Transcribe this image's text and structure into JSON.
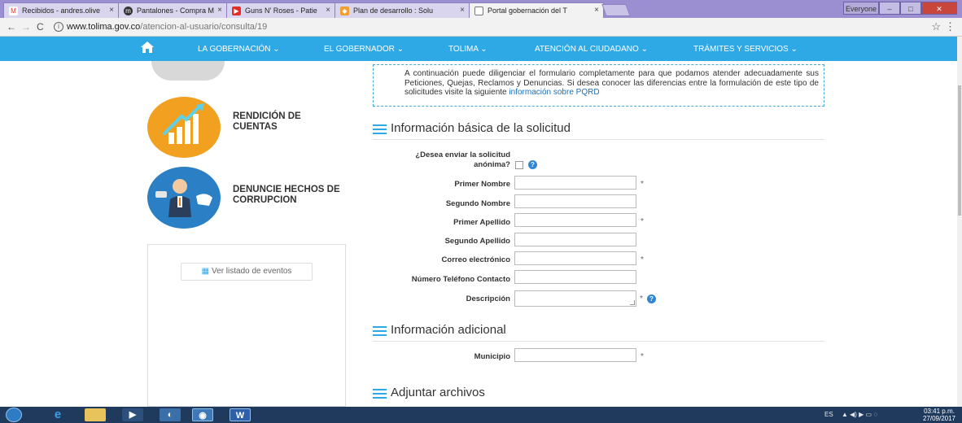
{
  "browser": {
    "tabs": [
      {
        "label": "Recibidos - andres.olive",
        "icon": "gmail-icon",
        "color": "#d23f31"
      },
      {
        "label": "Pantalones - Compra M",
        "icon": "store-icon",
        "color": "#333333"
      },
      {
        "label": "Guns N' Roses - Patie",
        "icon": "youtube-icon",
        "color": "#e52d27"
      },
      {
        "label": "Plan de desarrollo : Solu",
        "icon": "plan-icon",
        "color": "#f0a030"
      },
      {
        "label": "Portal gobernación del T",
        "icon": "page-icon",
        "color": "#777777"
      }
    ],
    "window_user": "Everyone",
    "url_host": "www.tolima.gov.co",
    "url_path": "/atencion-al-usuario/consulta/19"
  },
  "nav": {
    "items": [
      "LA GOBERNACIÓN ⌄",
      "EL GOBERNADOR ⌄",
      "TOLIMA ⌄",
      "ATENCIÓN AL CIUDADANO ⌄",
      "TRÁMITES Y SERVICIOS ⌄"
    ],
    "accent": "#2fa8e6"
  },
  "sidebar": {
    "rendicion_label": "RENDICIÓN DE CUENTAS",
    "denuncie_label": "DENUNCIE HECHOS DE CORRUPCION",
    "events_button": "Ver listado de eventos"
  },
  "intro": {
    "text": "A continuación puede diligenciar el formulario completamente para que podamos atender adecuadamente sus Peticiones, Quejas, Reclamos y Denuncias. Si desea conocer las diferencias entre la formulación de este tipo de solicitudes visite la siguiente",
    "link": "información sobre PQRD"
  },
  "sections": {
    "basic": "Información básica de la solicitud",
    "additional": "Información adicional",
    "attachments": "Adjuntar archivos"
  },
  "form": {
    "anonymous_line1": "¿Desea enviar la solicitud",
    "anonymous_line2": "anónima?",
    "primer_nombre": "Primer Nombre",
    "segundo_nombre": "Segundo Nombre",
    "primer_apellido": "Primer Apellido",
    "segundo_apellido": "Segundo Apellido",
    "correo": "Correo electrónico",
    "telefono": "Número Teléfono Contacto",
    "descripcion": "Descripción",
    "municipio": "Municipio",
    "required_mark": "*"
  },
  "taskbar": {
    "language": "ES",
    "time": "03:41 p.m.",
    "date": "27/09/2017"
  }
}
